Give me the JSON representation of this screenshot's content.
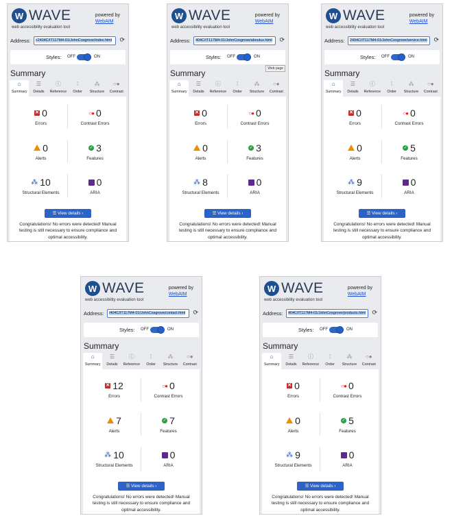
{
  "common": {
    "logo_letter": "W",
    "app_name": "WAVE",
    "tagline": "web accessibility evaluation tool",
    "powered_by": "powered by",
    "webaim": "WebAIM",
    "address_label": "Address:",
    "styles_label": "Styles:",
    "off": "OFF",
    "on": "ON",
    "summary_title": "Summary",
    "tabs": [
      "Summary",
      "Details",
      "Reference",
      "Order",
      "Structure",
      "Contrast"
    ],
    "labels": {
      "errors": "Errors",
      "contrast": "Contrast Errors",
      "alerts": "Alerts",
      "features": "Features",
      "structural": "Structural Elements",
      "aria": "ARIA"
    },
    "view_details": "View details ›",
    "congrats": "Congratulations! No errors were detected! Manual testing is still necessary to ensure compliance and optimal accessibility.",
    "tooltip": "Web page"
  },
  "panels": [
    {
      "address": "c2404C/IT117M4-01/JohnCosgrove/index.html",
      "errors": "0",
      "contrast": "0",
      "alerts": "0",
      "features": "3",
      "structural": "10",
      "aria": "0"
    },
    {
      "address": "404C/IT117M4-01/JohnCosgrove/aboutus.html",
      "errors": "0",
      "contrast": "0",
      "alerts": "0",
      "features": "3",
      "structural": "8",
      "aria": "0"
    },
    {
      "address": "2404C/IT117M4-01/JohnCosgrove/service.html",
      "errors": "0",
      "contrast": "0",
      "alerts": "0",
      "features": "5",
      "structural": "9",
      "aria": "0"
    },
    {
      "address": "/404C/IT117M4-01/JohnCosgrove/contact.html",
      "errors": "12",
      "contrast": "0",
      "alerts": "7",
      "features": "7",
      "structural": "10",
      "aria": "0"
    },
    {
      "address": "404C/IT117M4-01/JohnCosgrove/products.html",
      "errors": "0",
      "contrast": "0",
      "alerts": "0",
      "features": "5",
      "structural": "9",
      "aria": "0"
    }
  ]
}
